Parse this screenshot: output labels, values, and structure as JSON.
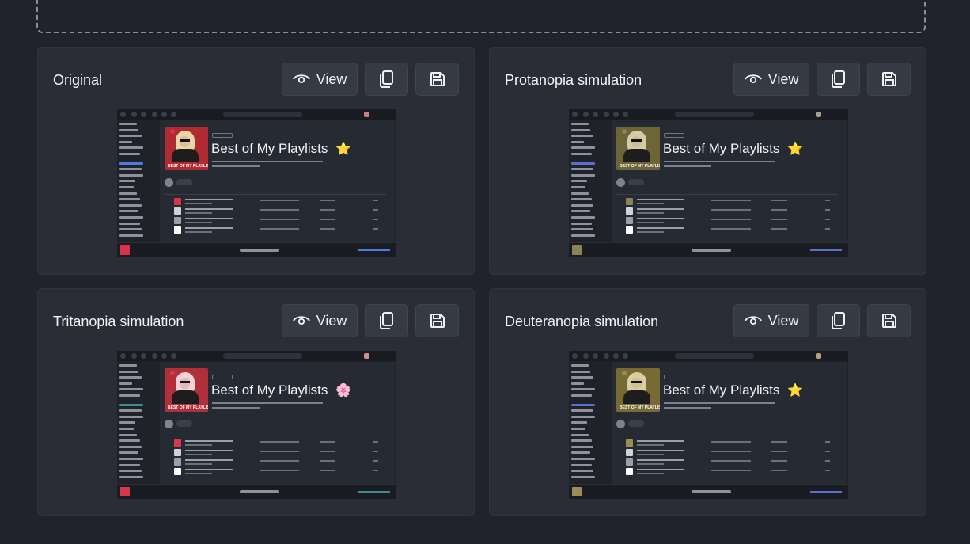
{
  "view_label": "View",
  "cards": [
    {
      "title": "Original",
      "accent": "#d9324a",
      "hair": "#e7d7a6",
      "face": "#e3b9a0",
      "band": "#b02a32",
      "star": "⭐",
      "avatar": "#c97f7f",
      "vol": "#4a7be0"
    },
    {
      "title": "Protanopia simulation",
      "accent": "#8a8355",
      "hair": "#d4cca2",
      "face": "#c8bf9c",
      "band": "#6d6437",
      "star": "⭐",
      "avatar": "#a59e8a",
      "vol": "#5a6fcf"
    },
    {
      "title": "Tritanopia simulation",
      "accent": "#d63a4a",
      "hair": "#f0d4d6",
      "face": "#e2b9bc",
      "band": "#b12f3a",
      "star": "🌸",
      "avatar": "#d58c93",
      "vol": "#3d8a94"
    },
    {
      "title": "Deuteranopia simulation",
      "accent": "#9a8d54",
      "hair": "#dccf9f",
      "face": "#cec192",
      "band": "#786a35",
      "star": "⭐",
      "avatar": "#b0a482",
      "vol": "#5a6fcf"
    }
  ],
  "thumbnail": {
    "playlist_title": "Best of My Playlists",
    "cover_text": "BEST OF MY PLAYLISTS"
  }
}
